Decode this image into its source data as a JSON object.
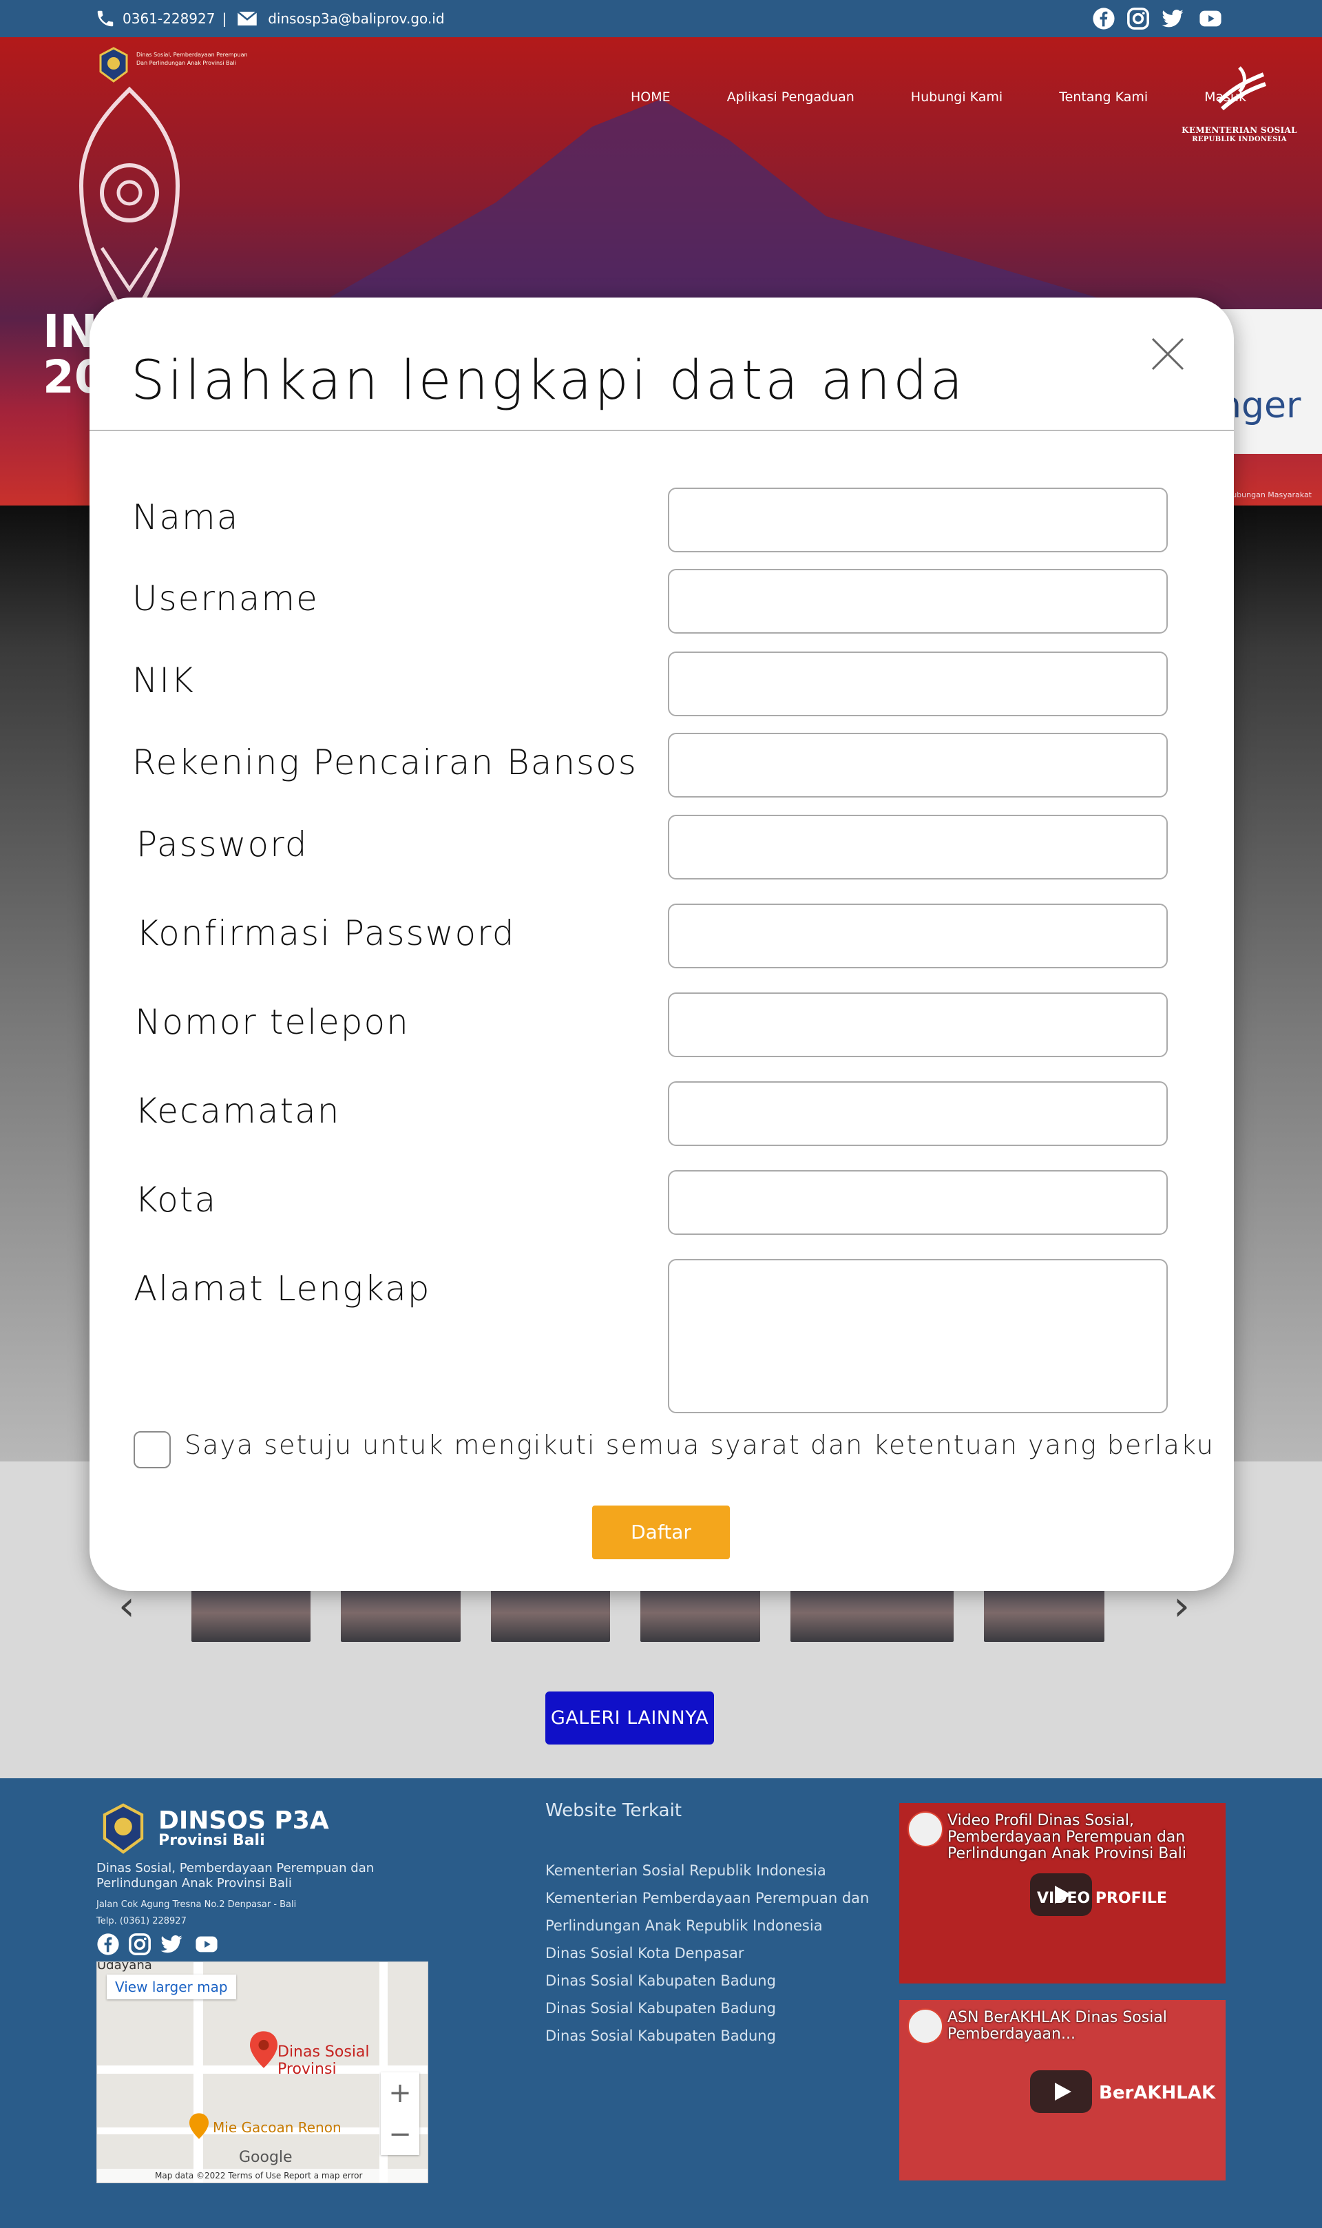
{
  "topbar": {
    "phone": "0361-228927",
    "separator": "|",
    "email": "dinsosp3a@baliprov.go.id",
    "social_icons": [
      "facebook-icon",
      "instagram-icon",
      "twitter-icon",
      "youtube-icon"
    ]
  },
  "header": {
    "org_small_line1": "Dinas Sosial, Pemberdayaan Perempuan",
    "org_small_line2": "Dan Perlindungan Anak Provinsi Bali",
    "nav": [
      "HOME",
      "Aplikasi Pengaduan",
      "Hubungi Kami",
      "Tentang Kami",
      "Masuk"
    ],
    "right_logo_line1": "KEMENTERIAN SOSIAL",
    "right_logo_line2": "REPUBLIK INDONESIA",
    "hero_right_fragment": "r\nnger",
    "hero_left_fragment1": "IN",
    "hero_left_fragment2": "20",
    "hero_small_right": "ubungan Masyarakat"
  },
  "modal": {
    "title": "Silahkan lengkapi data anda",
    "fields": [
      {
        "label": "Nama"
      },
      {
        "label": "Username"
      },
      {
        "label": "NIK"
      },
      {
        "label": "Rekening Pencairan Bansos"
      },
      {
        "label": "Password"
      },
      {
        "label": "Konfirmasi Password"
      },
      {
        "label": "Nomor telepon"
      },
      {
        "label": "Kecamatan"
      },
      {
        "label": "Kota"
      },
      {
        "label": "Alamat Lengkap"
      }
    ],
    "agree_text": "Saya setuju untuk mengikuti semua syarat dan ketentuan yang berlaku",
    "submit_label": "Daftar"
  },
  "gallery": {
    "button_label": "GALERI LAINNYA",
    "prev_arrow": "‹",
    "next_arrow": "›"
  },
  "footer": {
    "brand_title": "DINSOS P3A",
    "brand_sub": "Provinsi Bali",
    "desc": "Dinas Sosial, Pemberdayaan Perempuan dan Perlindungan Anak Provinsi Bali",
    "address": "Jalan Cok Agung Tresna No.2 Denpasar - Bali",
    "phone": "Telp. (0361) 228927",
    "map": {
      "view_larger": "View larger map",
      "pin_label": "Dinas Sosial Provinsi",
      "pin2_label": "Mie Gacoan Renon",
      "top_label": "Udayana",
      "google": "Google",
      "attribution": "Map data ©2022     Terms of Use     Report a map error",
      "zoom_in": "+",
      "zoom_out": "−"
    },
    "related_title": "Website Terkait",
    "related_links": [
      "Kementerian Sosial Republik Indonesia",
      "Kementerian Pemberdayaan Perempuan dan Perlindungan Anak Republik Indonesia",
      "Dinas Sosial Kota Denpasar",
      "Dinas Sosial Kabupaten Badung",
      "Dinas Sosial Kabupaten Badung",
      "Dinas Sosial Kabupaten Badung"
    ],
    "videos": [
      {
        "title": "Video Profil Dinas Sosial, Pemberdayaan Perempuan dan Perlindungan Anak Provinsi Bali",
        "overlay": "VIDEO PROFILE"
      },
      {
        "title": "ASN BerAKHLAK Dinas Sosial Pemberdayaan...",
        "overlay": "BerAKHLAK"
      }
    ]
  },
  "colors": {
    "topbar": "#2b5a86",
    "footer": "#2a5c8a",
    "daftar_button": "#f4a61c",
    "galeri_button": "#1010c8"
  }
}
